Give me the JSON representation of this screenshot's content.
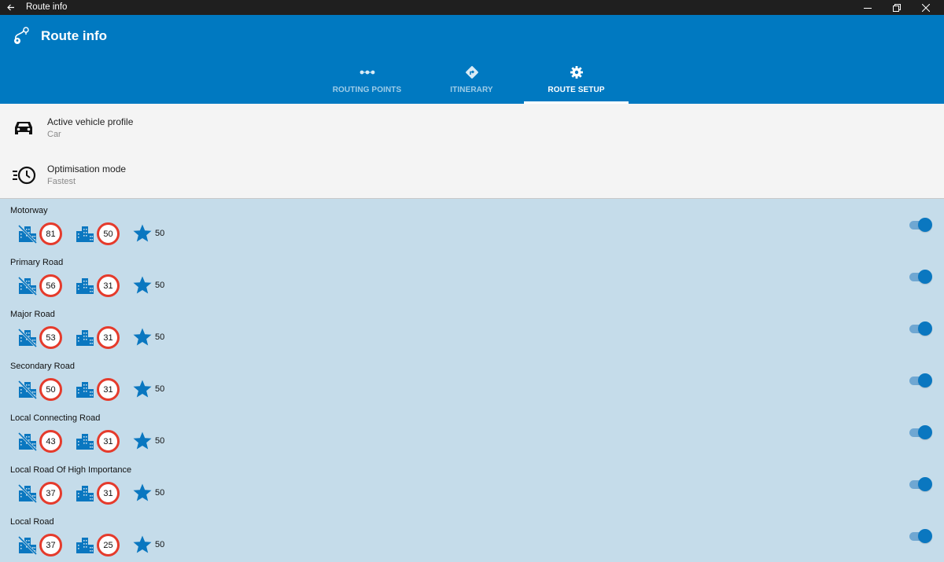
{
  "window": {
    "title": "Route info",
    "back_icon": "arrow-left-icon"
  },
  "header": {
    "title": "Route info",
    "icon": "route-icon",
    "background": "#0079c1"
  },
  "tabs": [
    {
      "label": "ROUTING POINTS",
      "icon": "dots-icon",
      "active": false
    },
    {
      "label": "ITINERARY",
      "icon": "turn-sign-icon",
      "active": false
    },
    {
      "label": "ROUTE SETUP",
      "icon": "gear-icon",
      "active": true
    }
  ],
  "profile": {
    "vehicle": {
      "title": "Active vehicle profile",
      "value": "Car",
      "icon": "car-icon"
    },
    "optimisation": {
      "title": "Optimisation mode",
      "value": "Fastest",
      "icon": "fast-clock-icon"
    }
  },
  "roads": [
    {
      "name": "Motorway",
      "rural_speed": "81",
      "urban_speed": "50",
      "priority": "50",
      "enabled": true
    },
    {
      "name": "Primary Road",
      "rural_speed": "56",
      "urban_speed": "31",
      "priority": "50",
      "enabled": true
    },
    {
      "name": "Major Road",
      "rural_speed": "53",
      "urban_speed": "31",
      "priority": "50",
      "enabled": true
    },
    {
      "name": "Secondary Road",
      "rural_speed": "50",
      "urban_speed": "31",
      "priority": "50",
      "enabled": true
    },
    {
      "name": "Local Connecting Road",
      "rural_speed": "43",
      "urban_speed": "31",
      "priority": "50",
      "enabled": true
    },
    {
      "name": "Local Road Of High Importance",
      "rural_speed": "37",
      "urban_speed": "31",
      "priority": "50",
      "enabled": true
    },
    {
      "name": "Local Road",
      "rural_speed": "37",
      "urban_speed": "25",
      "priority": "50",
      "enabled": true
    }
  ],
  "colors": {
    "accent": "#0079c1",
    "list_background": "#c5dcea",
    "speed_sign_border": "#e53b2c",
    "icon_blue": "#0a77c0"
  }
}
